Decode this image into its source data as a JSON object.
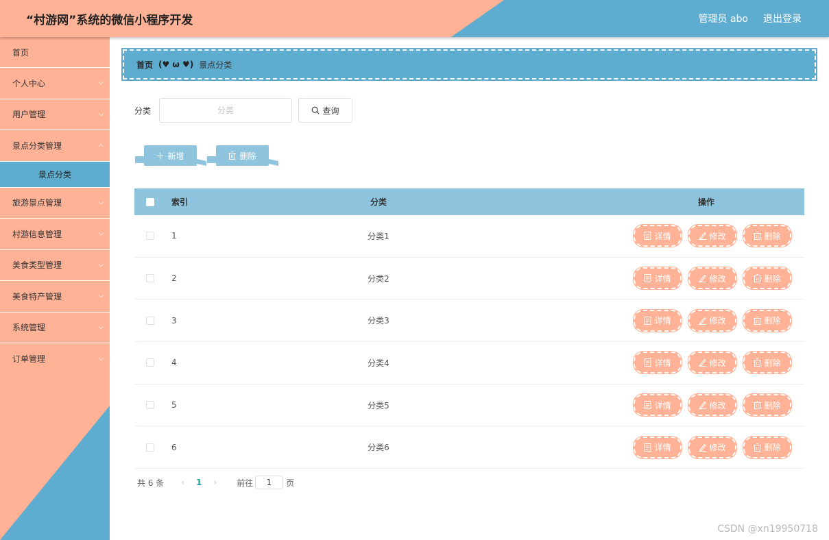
{
  "header": {
    "title": "“村游网”系统的微信小程序开发",
    "user_label": "管理员 abo",
    "logout_label": "退出登录"
  },
  "sidebar": {
    "items": [
      {
        "label": "首页",
        "has_arrow": false
      },
      {
        "label": "个人中心",
        "has_arrow": true
      },
      {
        "label": "用户管理",
        "has_arrow": true
      },
      {
        "label": "景点分类管理",
        "has_arrow": true
      },
      {
        "label": "旅游景点管理",
        "has_arrow": true
      },
      {
        "label": "村游信息管理",
        "has_arrow": true
      },
      {
        "label": "美食类型管理",
        "has_arrow": true
      },
      {
        "label": "美食特产管理",
        "has_arrow": true
      },
      {
        "label": "系统管理",
        "has_arrow": true
      },
      {
        "label": "订单管理",
        "has_arrow": true
      }
    ],
    "active_sub": "景点分类"
  },
  "breadcrumb": {
    "home": "首页",
    "separator": "(♥ ω ♥)",
    "current": "景点分类"
  },
  "search": {
    "label": "分类",
    "placeholder": "分类",
    "value": "",
    "button_label": "查询"
  },
  "toolbar": {
    "add_label": "新增",
    "delete_label": "删除"
  },
  "table": {
    "headers": {
      "index": "索引",
      "category": "分类",
      "actions": "操作"
    },
    "rows": [
      {
        "index": "1",
        "category": "分类1"
      },
      {
        "index": "2",
        "category": "分类2"
      },
      {
        "index": "3",
        "category": "分类3"
      },
      {
        "index": "4",
        "category": "分类4"
      },
      {
        "index": "5",
        "category": "分类5"
      },
      {
        "index": "6",
        "category": "分类6"
      }
    ],
    "row_actions": {
      "detail": "详情",
      "edit": "修改",
      "delete": "删除"
    }
  },
  "pagination": {
    "total": "共 6 条",
    "current_page": "1",
    "goto_label": "前往",
    "goto_value": "1",
    "page_unit": "页"
  },
  "watermark": "CSDN @xn19950718",
  "colors": {
    "peach": "#ffb296",
    "blue": "#5eacd0",
    "light_blue": "#8ec4de",
    "page_active": "#1aa39a"
  }
}
